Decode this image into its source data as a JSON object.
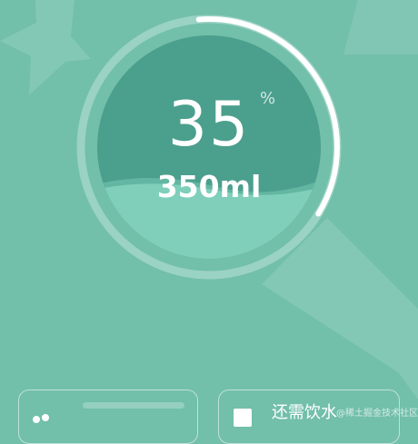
{
  "progress": {
    "percent_value": "35",
    "percent_unit": "%",
    "volume": "350ml",
    "fraction": 0.35
  },
  "cards": {
    "right_label": "还需饮水"
  },
  "watermark": "@稀土掘金技术社区",
  "colors": {
    "background": "#72bfaa",
    "inner_circle_top": "#4a9f8d",
    "water": "#7ecfbb",
    "ring_track": "#9cd2c4",
    "ring_progress": "#ffffff"
  },
  "icons": {
    "left_card_icon": "water-drops-icon",
    "right_card_icon": "cup-icon"
  }
}
